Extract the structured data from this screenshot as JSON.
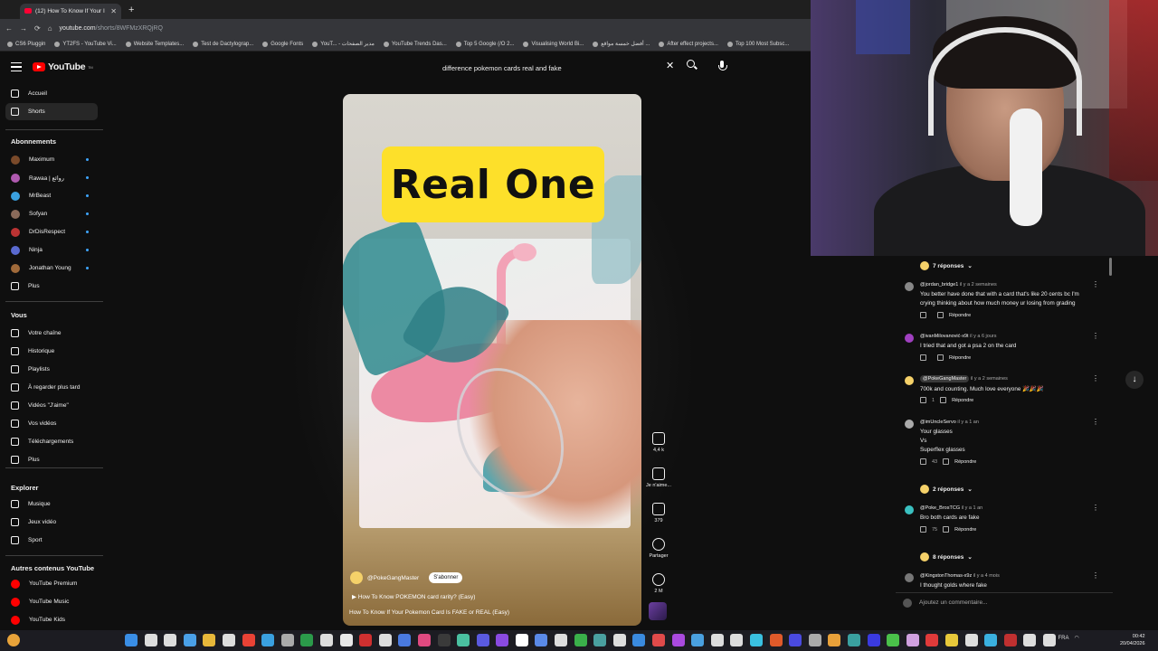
{
  "browser": {
    "tab_title": "(12) How To Know If Your I",
    "url_host": "youtube.com",
    "url_path": "/shorts/8WFMzXRQjRQ",
    "bookmarks": [
      "CS6 Pluggin",
      "YT2FS - YouTube Vi...",
      "Website Templates...",
      "Test de Dactylograp...",
      "Google Fonts",
      "YouT... - مدير الصفحات",
      "YouTube Trends Das...",
      "Top 5 Google (/O 2...",
      "Visualising World Bi...",
      "أفضل خمسة مواقع ...",
      "After effect projects...",
      "Top 100 Most Subsc..."
    ]
  },
  "header": {
    "logo_text": "YouTube",
    "logo_sup": "TM",
    "search_value": "difference pokemon cards real and fake"
  },
  "sidebar": {
    "main": [
      {
        "label": "Accueil",
        "icon": "home-icon"
      },
      {
        "label": "Shorts",
        "icon": "shorts-icon"
      }
    ],
    "subscriptions_title": "Abonnements",
    "subscriptions": [
      {
        "label": "Maximum",
        "color": "#7a4a2a"
      },
      {
        "label": "Rawaa | روائع",
        "color": "#b05ab0"
      },
      {
        "label": "MrBeast",
        "color": "#3aa0e0"
      },
      {
        "label": "Sofyan",
        "color": "#8a6a5a"
      },
      {
        "label": "DrDisRespect",
        "color": "#b33"
      },
      {
        "label": "Ninja",
        "color": "#5a6ad0"
      },
      {
        "label": "Jonathan Young",
        "color": "#a06a3a"
      }
    ],
    "more_label": "Plus",
    "you_title": "Vous",
    "you_items": [
      {
        "label": "Votre chaîne",
        "icon": "channel-icon"
      },
      {
        "label": "Historique",
        "icon": "history-icon"
      },
      {
        "label": "Playlists",
        "icon": "playlist-icon"
      },
      {
        "label": "À regarder plus tard",
        "icon": "clock-icon"
      },
      {
        "label": "Vidéos \"J'aime\"",
        "icon": "like-icon"
      },
      {
        "label": "Vos vidéos",
        "icon": "video-icon"
      },
      {
        "label": "Téléchargements",
        "icon": "download-icon"
      },
      {
        "label": "Plus",
        "icon": "chevron-down-icon"
      }
    ],
    "explore_title": "Explorer",
    "explore_items": [
      {
        "label": "Musique",
        "icon": "music-icon"
      },
      {
        "label": "Jeux vidéo",
        "icon": "gaming-icon"
      },
      {
        "label": "Sport",
        "icon": "trophy-icon"
      }
    ],
    "other_title": "Autres contenus YouTube",
    "other_items": [
      {
        "label": "YouTube Premium"
      },
      {
        "label": "YouTube Music"
      },
      {
        "label": "YouTube Kids"
      }
    ]
  },
  "short": {
    "overlay_text": "Real One",
    "channel": "@PokeGangMaster",
    "subscribe_label": "S'abonner",
    "linked_video": "How To Know POKEMON card rarity? (Easy)",
    "title": "How To Know If Your Pokemon Card Is FAKE or REAL (Easy)",
    "likes": "4,4 k",
    "dislike_label": "Je n'aime...",
    "comments_count": "379",
    "share_label": "Partager",
    "remix_count": "2 M"
  },
  "comments": {
    "top_replies": "7 réponses",
    "items": [
      {
        "user": "@jordan_bridge1",
        "time": "il y a 2 semaines",
        "lines": [
          "You better have done that with a card that's like 20 cents bc I'm",
          "crying thinking about how much money ur losing from grading"
        ],
        "likes": "",
        "reply": "Répondre",
        "avatar": "#888"
      },
      {
        "user": "@ivanMilovanović-x9t",
        "time": "il y a 6 jours",
        "lines": [
          "I tried that and got a psa 2 on the card"
        ],
        "likes": "",
        "reply": "Répondre",
        "avatar": "#a040c0"
      },
      {
        "user": "@PokeGangMaster",
        "time": "il y a 2 semaines",
        "lines": [
          "700k and counting. Much love everyone 🎉🎉🎉"
        ],
        "likes": "1",
        "reply": "Répondre",
        "avatar": "#f5d169"
      },
      {
        "user": "@imUncleServo",
        "time": "il y a 1 an",
        "lines": [
          "Your glasses",
          "Vs",
          "Superflex glasses"
        ],
        "likes": "43",
        "reply": "Répondre",
        "avatar": "#aaa"
      },
      {
        "user": "@Poke_BrosTCG",
        "time": "il y a 1 an",
        "lines": [
          "Bro both cards are fake"
        ],
        "likes": "75",
        "reply": "Répondre",
        "avatar": "#3ac0c0"
      },
      {
        "user": "@KingstonThomas-x9z",
        "time": "il y a 4 mois",
        "lines": [
          "I thought golds where fake"
        ],
        "likes": "",
        "reply": "",
        "avatar": "#777"
      }
    ],
    "replies_2": "2 réponses",
    "replies_8": "8 réponses",
    "add_placeholder": "Ajoutez un commentaire..."
  },
  "taskbar": {
    "lang": "FRA",
    "time": "00:42",
    "date": "20/04/2026"
  }
}
